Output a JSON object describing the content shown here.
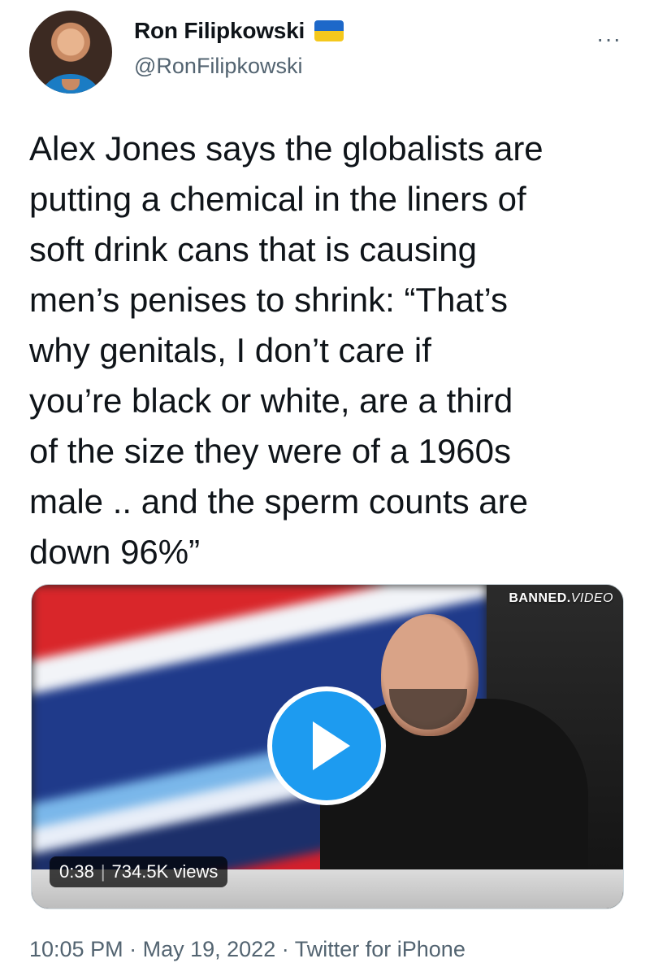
{
  "author": {
    "display_name": "Ron Filipkowski",
    "handle": "@RonFilipkowski",
    "badge": "ukraine-flag-icon"
  },
  "more_label": "···",
  "tweet_text": "Alex Jones says the globalists are\nputting a chemical in the liners of\nsoft drink cans that is causing\nmen’s penises to shrink: “That’s\nwhy genitals, I don’t care if\nyou’re black or white, are a third\nof the size they were of a 1960s\nmale .. and the sperm counts are\ndown 96%”",
  "media": {
    "watermark_banned": "BANNED.",
    "watermark_video": "VIDEO",
    "duration": "0:38",
    "views": "734.5K views"
  },
  "footer": {
    "time": "10:05 PM",
    "date": "May 19, 2022",
    "client": "Twitter for iPhone",
    "dot": "·"
  },
  "colors": {
    "accent": "#1d9bf0",
    "secondary_text": "#536471"
  }
}
